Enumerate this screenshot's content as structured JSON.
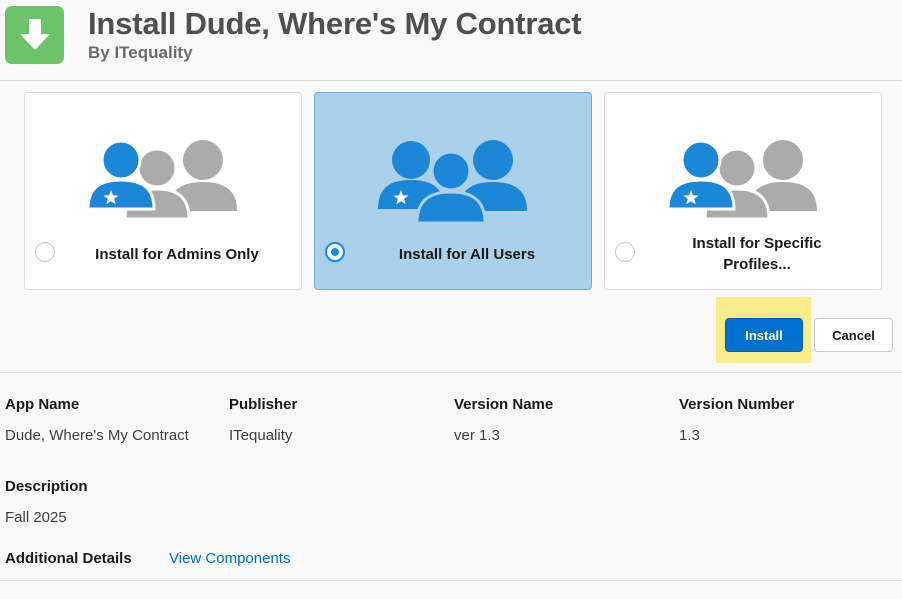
{
  "header": {
    "icon": "download-arrow-icon",
    "title": "Install Dude, Where's My Contract",
    "subtitle": "By ITequality"
  },
  "install_options": [
    {
      "label": "Install for Admins Only",
      "icon": "admin-users-icon",
      "selected": false
    },
    {
      "label": "Install for All Users",
      "icon": "all-users-icon",
      "selected": true
    },
    {
      "label_line1": "Install for Specific",
      "label_line2": "Profiles...",
      "icon": "specific-profiles-icon",
      "selected": false
    }
  ],
  "actions": {
    "install_label": "Install",
    "cancel_label": "Cancel"
  },
  "details": {
    "app_name_label": "App Name",
    "app_name": "Dude, Where's My Contract",
    "publisher_label": "Publisher",
    "publisher": "ITequality",
    "version_name_label": "Version Name",
    "version_name": "ver 1.3",
    "version_number_label": "Version Number",
    "version_number": "1.3",
    "description_label": "Description",
    "description": "Fall 2025",
    "additional_label": "Additional Details",
    "view_components": "View Components"
  },
  "colors": {
    "accent": "#0070d2",
    "selected_card": "#abd0ea",
    "icon_green": "#6cc46a",
    "person_blue": "#1b87d6",
    "person_gray": "#a9a9a9",
    "highlight": "#fbec8a"
  }
}
